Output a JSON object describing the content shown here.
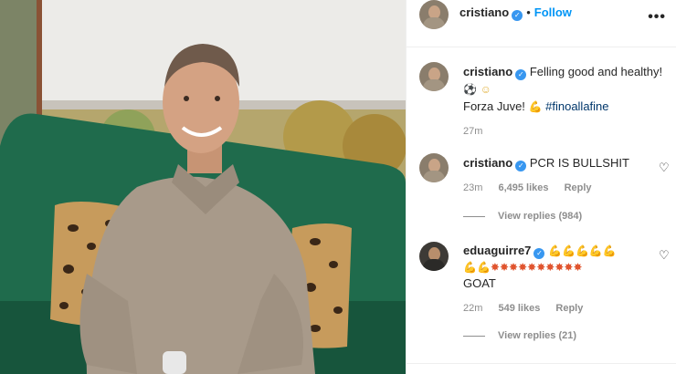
{
  "header": {
    "username": "cristiano",
    "follow_label": "Follow",
    "more_label": "•••"
  },
  "caption": {
    "username": "cristiano",
    "text_line1": "Felling good and healthy!",
    "text_line2_start": "Forza Juve!",
    "hashtag": "#finoallafine",
    "time": "27m",
    "emoji": [
      "soccer-ball",
      "smile",
      "flexed-biceps"
    ]
  },
  "comments": [
    {
      "username": "cristiano",
      "text": "PCR IS BULLSHIT",
      "time": "23m",
      "likes": "6,495 likes",
      "reply_label": "Reply",
      "view_replies": "View replies (984)"
    },
    {
      "username": "eduaguirre7",
      "text": "GOAT",
      "time": "22m",
      "likes": "549 likes",
      "reply_label": "Reply",
      "view_replies": "View replies (21)",
      "emoji_line1": [
        "flexed-biceps",
        "flexed-biceps",
        "flexed-biceps",
        "flexed-biceps",
        "flexed-biceps"
      ],
      "emoji_line2": [
        "flexed-biceps",
        "flexed-biceps",
        "collision",
        "collision",
        "collision",
        "collision",
        "collision",
        "collision",
        "collision",
        "collision",
        "collision",
        "collision"
      ]
    }
  ],
  "colors": {
    "link_blue": "#0095f6",
    "verified_blue": "#3897f0",
    "meta_gray": "#8e8e8e",
    "hashtag_blue": "#00376b",
    "sofa_green": "#1f6b4c"
  }
}
